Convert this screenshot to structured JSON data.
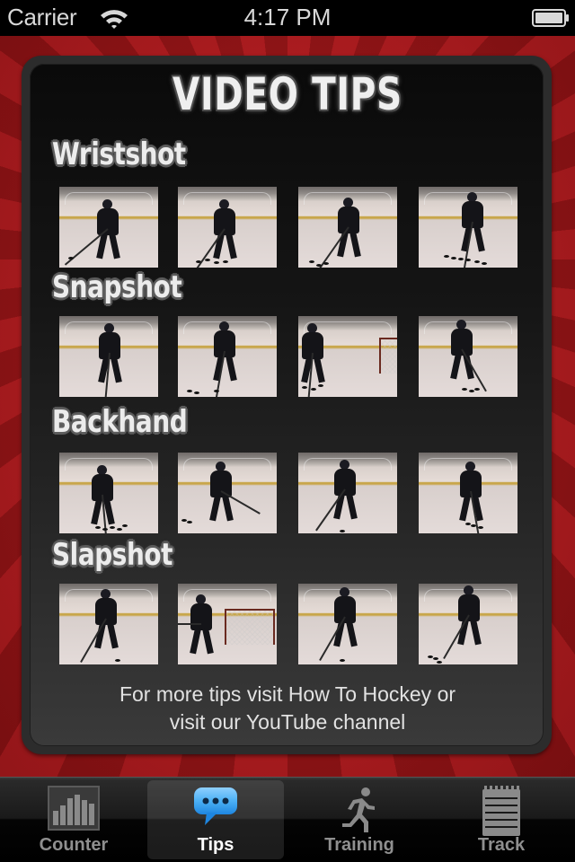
{
  "status_bar": {
    "carrier": "Carrier",
    "time": "4:17 PM",
    "wifi_icon": "wifi-icon",
    "battery_icon": "battery-icon"
  },
  "page": {
    "title": "Video Tips"
  },
  "sections": [
    {
      "label": "Wristshot",
      "videos": [
        {
          "label": "Wristshot video 1",
          "icon": "video-thumbnail"
        },
        {
          "label": "Wristshot video 2",
          "icon": "video-thumbnail"
        },
        {
          "label": "Wristshot video 3",
          "icon": "video-thumbnail"
        },
        {
          "label": "Wristshot video 4",
          "icon": "video-thumbnail"
        }
      ]
    },
    {
      "label": "Snapshot",
      "videos": [
        {
          "label": "Snapshot video 1",
          "icon": "video-thumbnail"
        },
        {
          "label": "Snapshot video 2",
          "icon": "video-thumbnail"
        },
        {
          "label": "Snapshot video 3",
          "icon": "video-thumbnail"
        },
        {
          "label": "Snapshot video 4",
          "icon": "video-thumbnail"
        }
      ]
    },
    {
      "label": "Backhand",
      "videos": [
        {
          "label": "Backhand video 1",
          "icon": "video-thumbnail"
        },
        {
          "label": "Backhand video 2",
          "icon": "video-thumbnail"
        },
        {
          "label": "Backhand video 3",
          "icon": "video-thumbnail"
        },
        {
          "label": "Backhand video 4",
          "icon": "video-thumbnail"
        }
      ]
    },
    {
      "label": "Slapshot",
      "videos": [
        {
          "label": "Slapshot video 1",
          "icon": "video-thumbnail"
        },
        {
          "label": "Slapshot video 2",
          "icon": "video-thumbnail"
        },
        {
          "label": "Slapshot video 3",
          "icon": "video-thumbnail"
        },
        {
          "label": "Slapshot video 4",
          "icon": "video-thumbnail"
        }
      ]
    }
  ],
  "footer": {
    "line1": "For more tips visit How To Hockey or",
    "line2": "visit our YouTube channel"
  },
  "tab_bar": {
    "selected": "Tips",
    "tabs": [
      {
        "label": "Counter",
        "icon": "bar-chart-icon"
      },
      {
        "label": "Tips",
        "icon": "speech-bubble-icon"
      },
      {
        "label": "Training",
        "icon": "running-man-icon"
      },
      {
        "label": "Track",
        "icon": "notepad-icon"
      }
    ]
  },
  "colors": {
    "background_red": "#b01c1f",
    "panel": "#2c2c2c",
    "tab_selected_icon": "#3fa4f0",
    "tab_inactive": "#8f8f8f"
  }
}
